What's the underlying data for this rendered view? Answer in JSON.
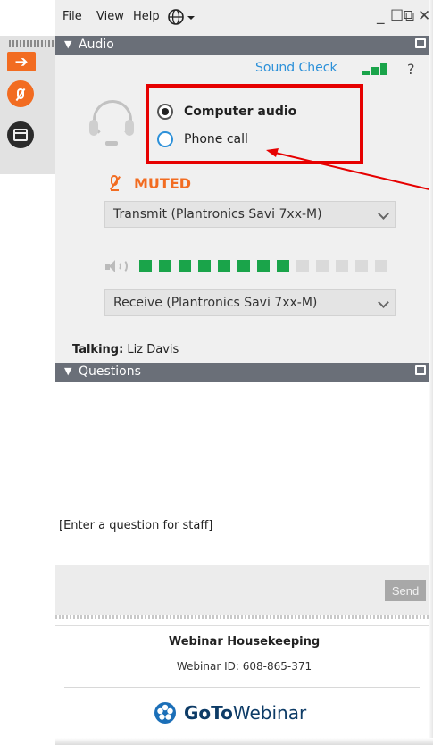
{
  "menu": {
    "file": "File",
    "view": "View",
    "help": "Help",
    "globe_icon": "globe-icon",
    "minimize": "_",
    "restore": "☐",
    "popout": "⧉",
    "close": "✕"
  },
  "grabtab": {
    "arrow_icon": "arrow-right-icon",
    "mute_icon": "muted-mic-icon",
    "screen_icon": "screen-icon"
  },
  "audio": {
    "header": "Audio",
    "sound_check": "Sound Check",
    "help": "?",
    "options": [
      {
        "label": "Computer audio",
        "selected": true
      },
      {
        "label": "Phone call",
        "selected": false
      }
    ],
    "muted": "MUTED",
    "transmit": "Transmit (Plantronics Savi 7xx-M)",
    "receive": "Receive (Plantronics Savi 7xx-M)",
    "level_filled": 8,
    "level_total": 13,
    "talking_label": "Talking:",
    "talking_name": "Liz Davis",
    "accent_color": "#f26c21",
    "level_color": "#1aa44a",
    "highlight_color": "#e60000"
  },
  "questions": {
    "header": "Questions",
    "placeholder": "[Enter a question for staff]",
    "send": "Send"
  },
  "footer": {
    "title": "Webinar Housekeeping",
    "webinar_id": "Webinar ID: 608-865-371",
    "brand_go": "GoTo",
    "brand_rest": "Webinar"
  }
}
